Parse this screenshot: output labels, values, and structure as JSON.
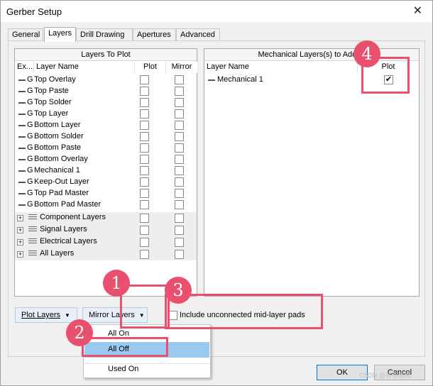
{
  "window": {
    "title": "Gerber Setup",
    "close_glyph": "✕"
  },
  "tabs": [
    {
      "label": "General"
    },
    {
      "label": "Layers"
    },
    {
      "label": "Drill Drawing"
    },
    {
      "label": "Apertures"
    },
    {
      "label": "Advanced"
    }
  ],
  "layers_panel": {
    "title": "Layers To Plot",
    "col_ext": "Ex...",
    "col_name": "Layer Name",
    "col_plot": "Plot",
    "col_mirror": "Mirror",
    "rows": [
      {
        "tag": "G",
        "name": "Top Overlay"
      },
      {
        "tag": "G",
        "name": "Top Paste"
      },
      {
        "tag": "G",
        "name": "Top Solder"
      },
      {
        "tag": "G",
        "name": "Top Layer"
      },
      {
        "tag": "G",
        "name": "Bottom Layer"
      },
      {
        "tag": "G",
        "name": "Bottom Solder"
      },
      {
        "tag": "G",
        "name": "Bottom Paste"
      },
      {
        "tag": "G",
        "name": "Bottom Overlay"
      },
      {
        "tag": "G",
        "name": "Mechanical 1"
      },
      {
        "tag": "G",
        "name": "Keep-Out Layer"
      },
      {
        "tag": "G",
        "name": "Top Pad Master"
      },
      {
        "tag": "G",
        "name": "Bottom Pad Master"
      }
    ],
    "groups": [
      {
        "name": "Component Layers"
      },
      {
        "name": "Signal Layers"
      },
      {
        "name": "Electrical Layers"
      },
      {
        "name": "All Layers"
      }
    ]
  },
  "mech_panel": {
    "title": "Mechanical Layers(s) to Add to",
    "col_name": "Layer Name",
    "col_plot": "Plot",
    "rows": [
      {
        "name": "Mechanical 1",
        "plot_checked": true
      }
    ]
  },
  "buttons": {
    "plot_layers": "Plot Layers",
    "mirror_layers": "Mirror Layers",
    "ok": "OK",
    "cancel": "Cancel"
  },
  "include_unconnected": {
    "label": "Include unconnected mid-layer pads",
    "checked": false
  },
  "dropdown_menu": {
    "items": [
      {
        "label": "All On"
      },
      {
        "label": "All Off"
      },
      {
        "label": "Used On"
      }
    ],
    "selected": "All Off"
  },
  "annotations": [
    "1",
    "2",
    "3",
    "4"
  ],
  "watermark": "CSDN @普普桐风",
  "colors": {
    "annotation": "#e8506d",
    "menu_highlight": "#99c9ef"
  }
}
